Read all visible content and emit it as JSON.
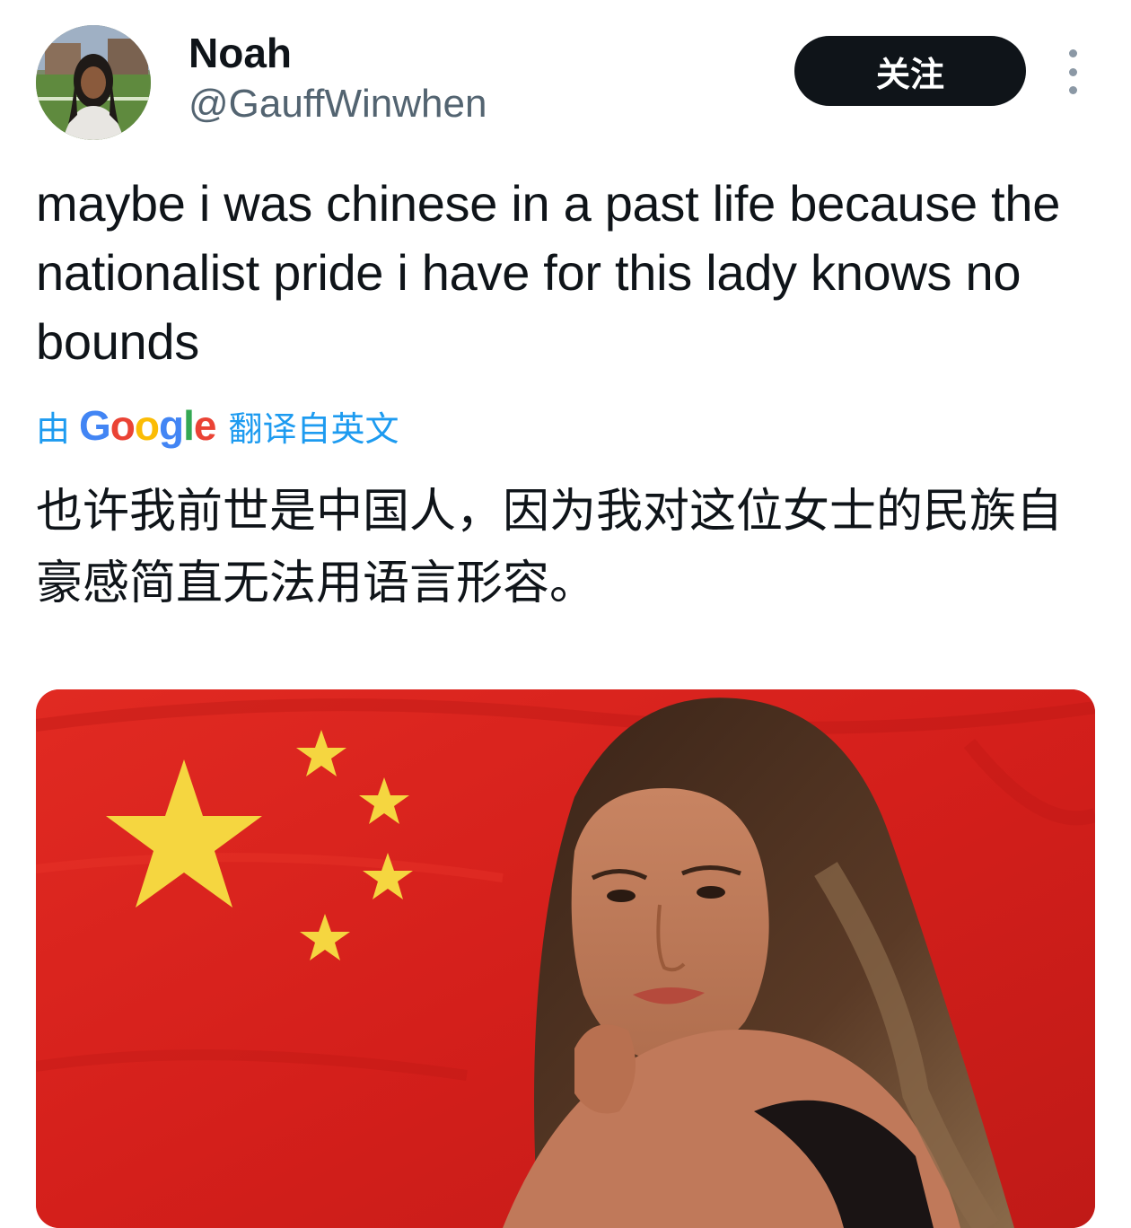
{
  "tweet": {
    "author_name": "Noah",
    "author_handle": "@GauffWinwhen",
    "follow_label": "关注",
    "text": "maybe i was chinese in a past life because the nationalist pride i have for this lady knows no bounds",
    "translation": {
      "prefix": "由",
      "provider_letters": [
        "G",
        "o",
        "o",
        "g",
        "l",
        "e"
      ],
      "suffix": "翻译自英文",
      "text": "也许我前世是中国人，因为我对这位女士的民族自豪感简直无法用语言形容。"
    },
    "media": {
      "icons": [
        "flag-star-icon"
      ],
      "colors": {
        "flag_red": "#d8201c",
        "star_yellow": "#f5d640"
      }
    }
  },
  "colors": {
    "primary_text": "#0f1419",
    "secondary_text": "#536471",
    "link": "#1d9bf0",
    "button_bg": "#0f1419",
    "button_text": "#ffffff"
  }
}
